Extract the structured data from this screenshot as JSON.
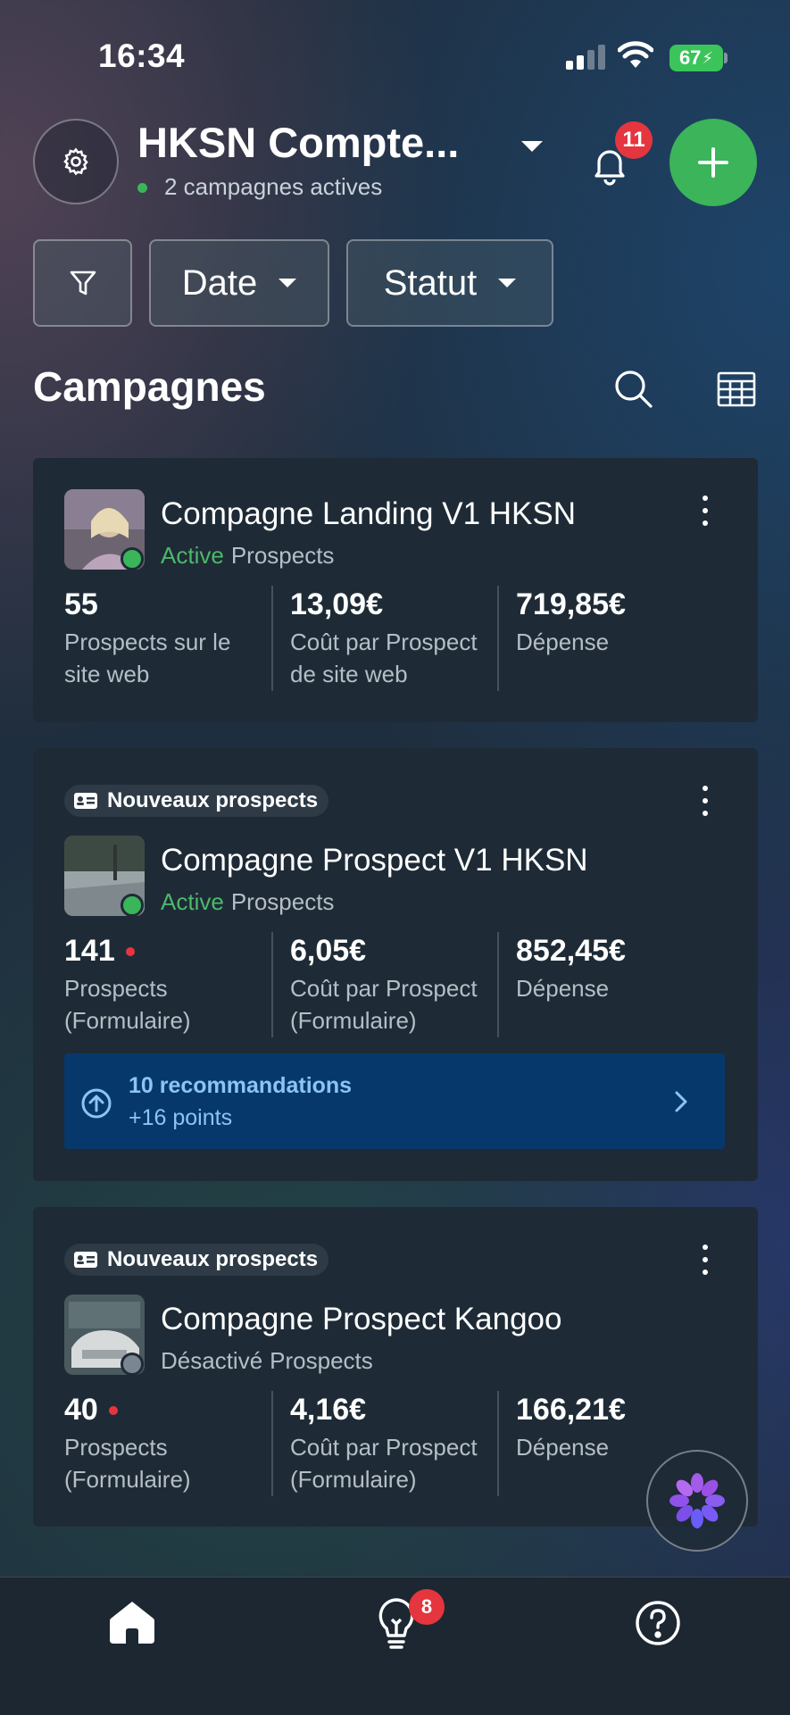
{
  "status_bar": {
    "time": "16:34",
    "battery": "67"
  },
  "header": {
    "account_name": "HKSN Compte...",
    "subtitle": "2 campagnes actives",
    "notifications_count": "11",
    "colors": {
      "add_button": "#3cb45a",
      "badge": "#e5353e",
      "active": "#4cb86a"
    }
  },
  "filters": {
    "date_label": "Date",
    "status_label": "Statut"
  },
  "section": {
    "title": "Campagnes"
  },
  "campaigns": [
    {
      "name": "Compagne Landing V1 HKSN",
      "status": "Active",
      "objective": "Prospects",
      "metrics": [
        {
          "value": "55",
          "label_line1": "Prospects sur le",
          "label_line2": "site web"
        },
        {
          "value": "13,09€",
          "label_line1": "Coût par Prospect",
          "label_line2": "de site web"
        },
        {
          "value": "719,85€",
          "label_line1": "Dépense",
          "label_line2": ""
        }
      ]
    },
    {
      "badge": "Nouveaux prospects",
      "name": "Compagne Prospect V1 HKSN",
      "status": "Active",
      "objective": "Prospects",
      "metrics": [
        {
          "value": "141",
          "label_line1": "Prospects",
          "label_line2": "(Formulaire)"
        },
        {
          "value": "6,05€",
          "label_line1": "Coût par Prospect",
          "label_line2": "(Formulaire)"
        },
        {
          "value": "852,45€",
          "label_line1": "Dépense",
          "label_line2": ""
        }
      ],
      "recommendation": {
        "title": "10 recommandations",
        "subtitle": "+16 points"
      }
    },
    {
      "badge": "Nouveaux prospects",
      "name": "Compagne Prospect Kangoo",
      "status": "Désactivé",
      "objective": "Prospects",
      "metrics": [
        {
          "value": "40",
          "label_line1": "Prospects",
          "label_line2": "(Formulaire)"
        },
        {
          "value": "4,16€",
          "label_line1": "Coût par Prospect",
          "label_line2": "(Formulaire)"
        },
        {
          "value": "166,21€",
          "label_line1": "Dépense",
          "label_line2": ""
        }
      ]
    }
  ],
  "bottom_nav": {
    "ideas_badge": "8",
    "icons": [
      "home-icon",
      "lightbulb-icon",
      "help-icon"
    ]
  }
}
